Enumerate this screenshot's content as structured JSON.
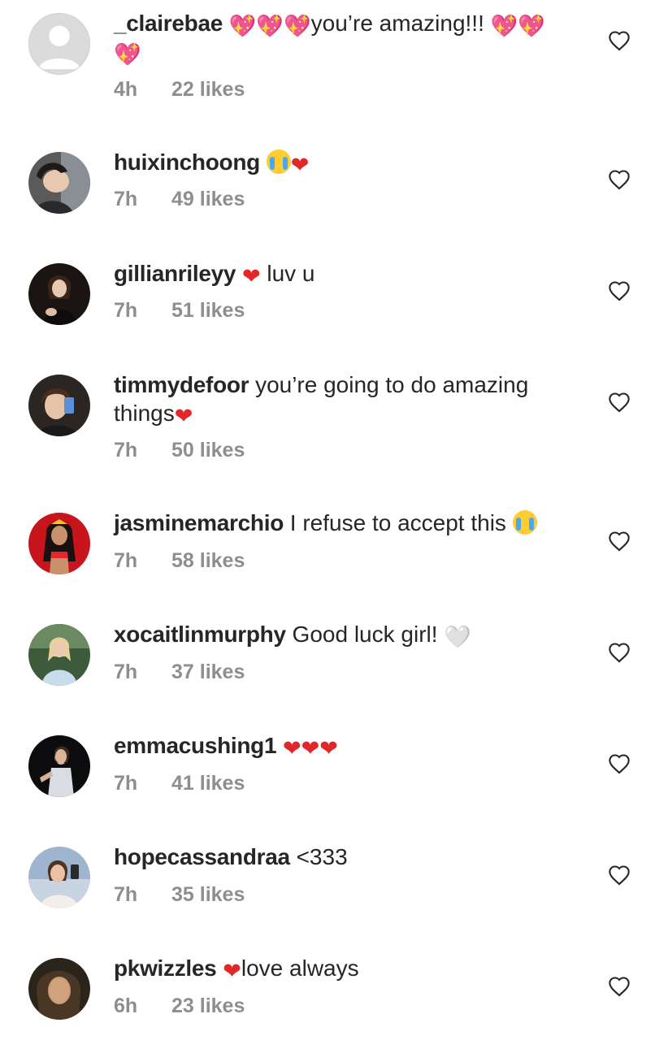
{
  "comments": [
    {
      "username": "_clairebae",
      "text_segments": [
        "",
        "you’re amazing!!! ",
        ""
      ],
      "emojis": [
        "💖💖💖",
        "💖💖",
        "💖"
      ],
      "time": "4h",
      "likes": "22 likes",
      "avatar": "default-avatar"
    },
    {
      "username": "huixinchoong",
      "text": "",
      "emojis": [
        "😭",
        "❤"
      ],
      "time": "7h",
      "likes": "49 likes",
      "avatar": "profile-photo"
    },
    {
      "username": "gillianrileyy",
      "text": " luv u",
      "emojis": [
        "❤"
      ],
      "time": "7h",
      "likes": "51 likes",
      "avatar": "profile-photo"
    },
    {
      "username": "timmydefoor",
      "text": "you’re going to do amazing things",
      "emojis": [
        "❤"
      ],
      "time": "7h",
      "likes": "50 likes",
      "avatar": "profile-photo"
    },
    {
      "username": "jasminemarchio",
      "text": "I refuse to accept this ",
      "emojis": [
        "😭"
      ],
      "time": "7h",
      "likes": "58 likes",
      "avatar": "profile-photo"
    },
    {
      "username": "xocaitlinmurphy",
      "text": "Good luck girl! ",
      "emojis": [
        "🤍"
      ],
      "time": "7h",
      "likes": "37 likes",
      "avatar": "profile-photo"
    },
    {
      "username": "emmacushing1",
      "text": "",
      "emojis": [
        "❤❤❤"
      ],
      "time": "7h",
      "likes": "41 likes",
      "avatar": "profile-photo"
    },
    {
      "username": "hopecassandraa",
      "text": "<333",
      "emojis": [],
      "time": "7h",
      "likes": "35 likes",
      "avatar": "profile-photo"
    },
    {
      "username": "pkwizzles",
      "text": "love always",
      "emojis": [
        "❤"
      ],
      "time": "6h",
      "likes": "23 likes",
      "avatar": "profile-photo"
    }
  ],
  "icons": {
    "like": "heart-outline-icon",
    "default_avatar": "person-silhouette-icon"
  },
  "colors": {
    "text_primary": "#262626",
    "text_secondary": "#8e8e8e",
    "heart_red": "#e02828",
    "sparkle_heart": "#ff4fa0",
    "white_heart": "#d9d9d9"
  }
}
